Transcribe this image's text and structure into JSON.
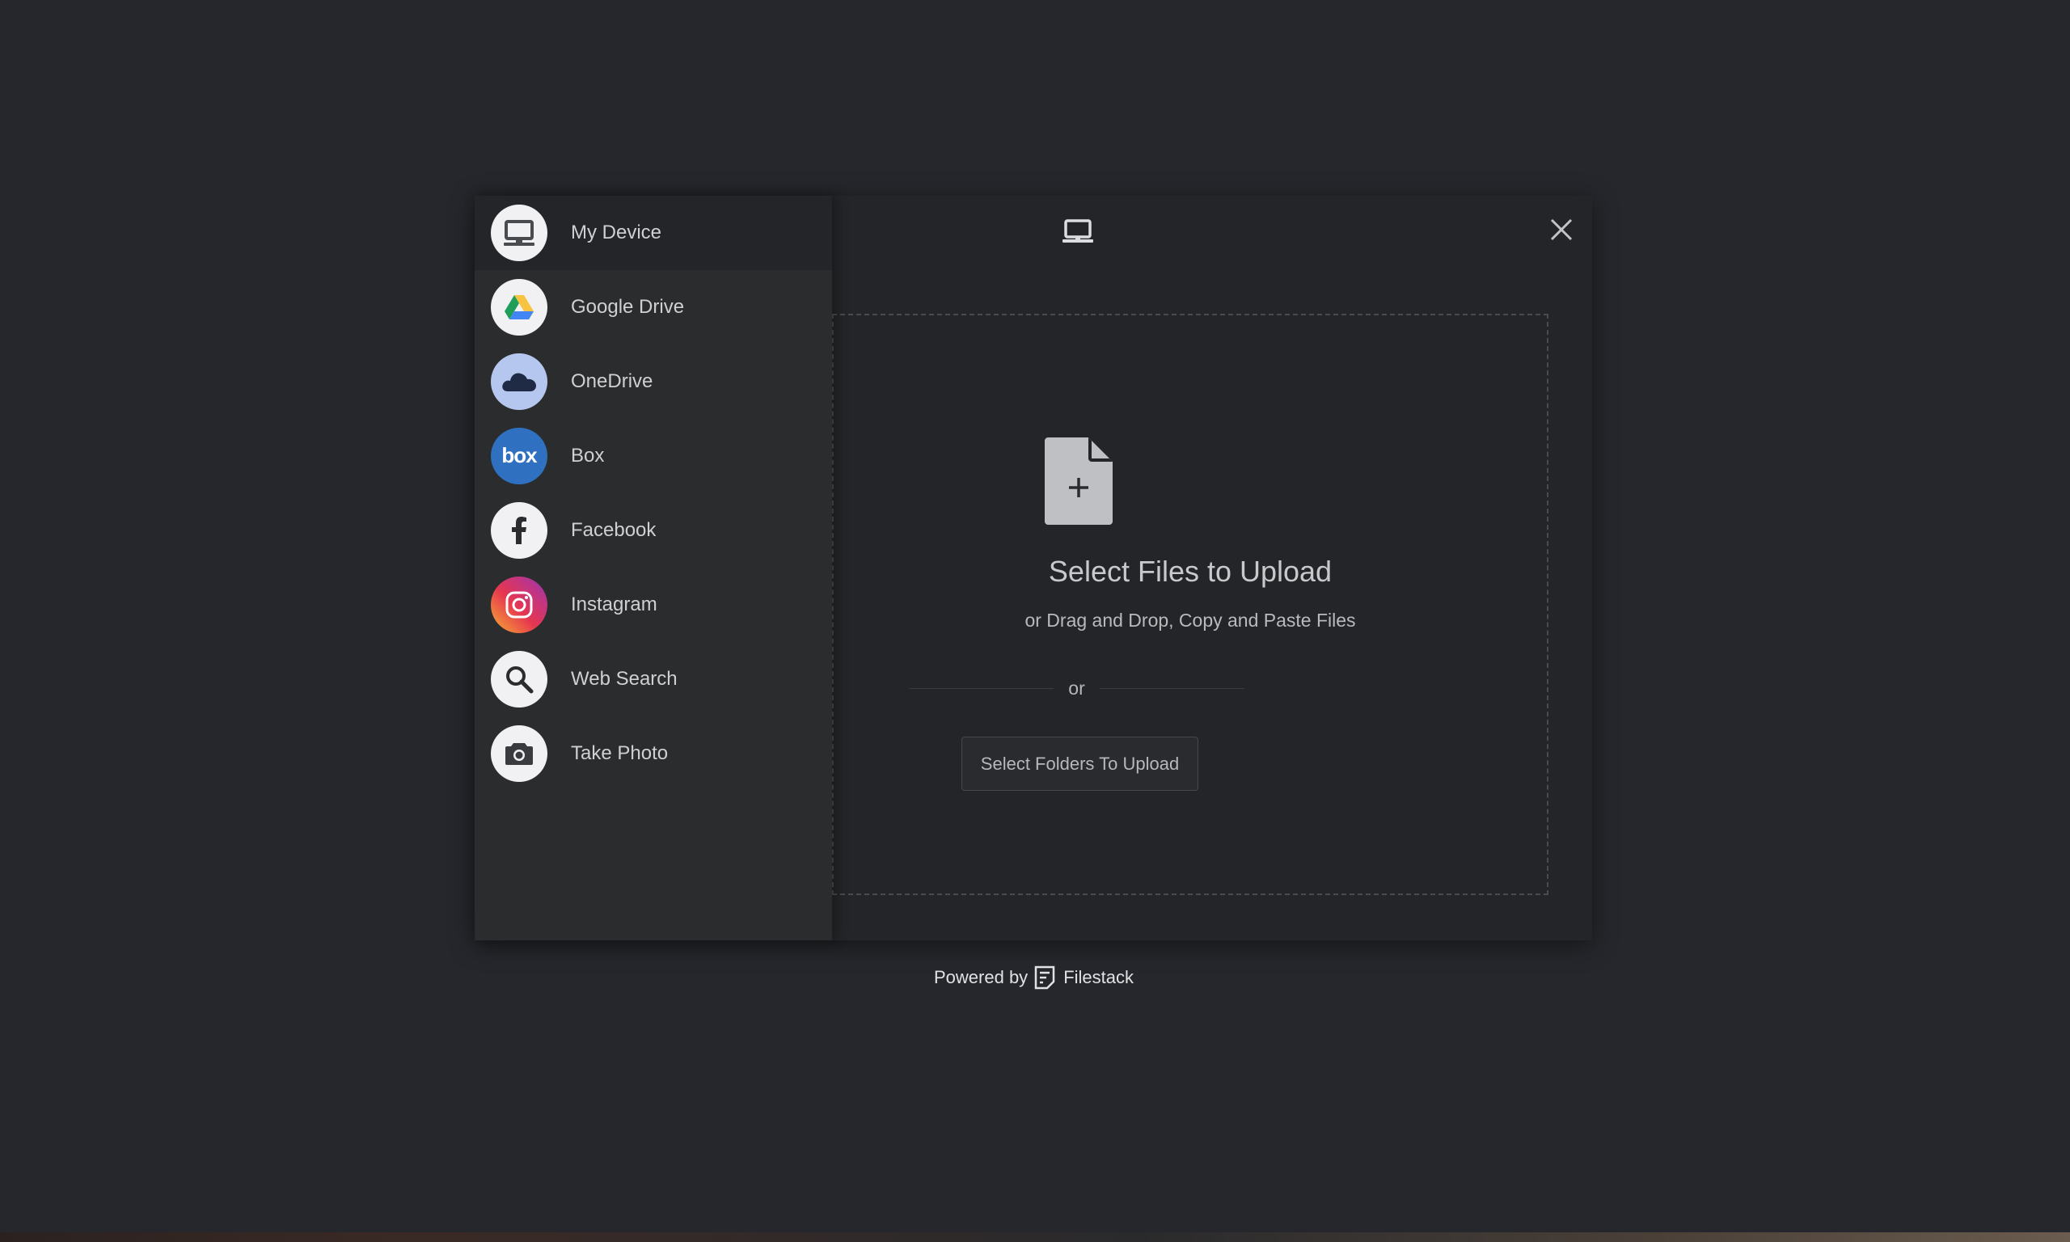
{
  "sources": [
    {
      "label": "My Device",
      "icon": "monitor-icon",
      "active": true
    },
    {
      "label": "Google Drive",
      "icon": "google-drive-icon",
      "active": false
    },
    {
      "label": "OneDrive",
      "icon": "onedrive-icon",
      "active": false
    },
    {
      "label": "Box",
      "icon": "box-icon",
      "active": false
    },
    {
      "label": "Facebook",
      "icon": "facebook-icon",
      "active": false
    },
    {
      "label": "Instagram",
      "icon": "instagram-icon",
      "active": false
    },
    {
      "label": "Web Search",
      "icon": "search-icon",
      "active": false
    },
    {
      "label": "Take Photo",
      "icon": "camera-icon",
      "active": false
    }
  ],
  "header": {
    "icon": "monitor-icon",
    "close_icon": "close-icon"
  },
  "dropzone": {
    "icon": "file-plus-icon",
    "title": "Select Files to Upload",
    "subtitle": "or Drag and Drop, Copy and Paste Files",
    "divider_text": "or",
    "folders_button_label": "Select Folders To Upload"
  },
  "footer": {
    "powered_by": "Powered by",
    "brand": "Filestack",
    "brand_icon": "filestack-logo-icon"
  },
  "colors": {
    "background": "#26272c",
    "modal": "#242528",
    "sidebar": "#2a2c2e",
    "box_brand": "#2f71c0",
    "onedrive_bg": "#b5c7ef"
  }
}
